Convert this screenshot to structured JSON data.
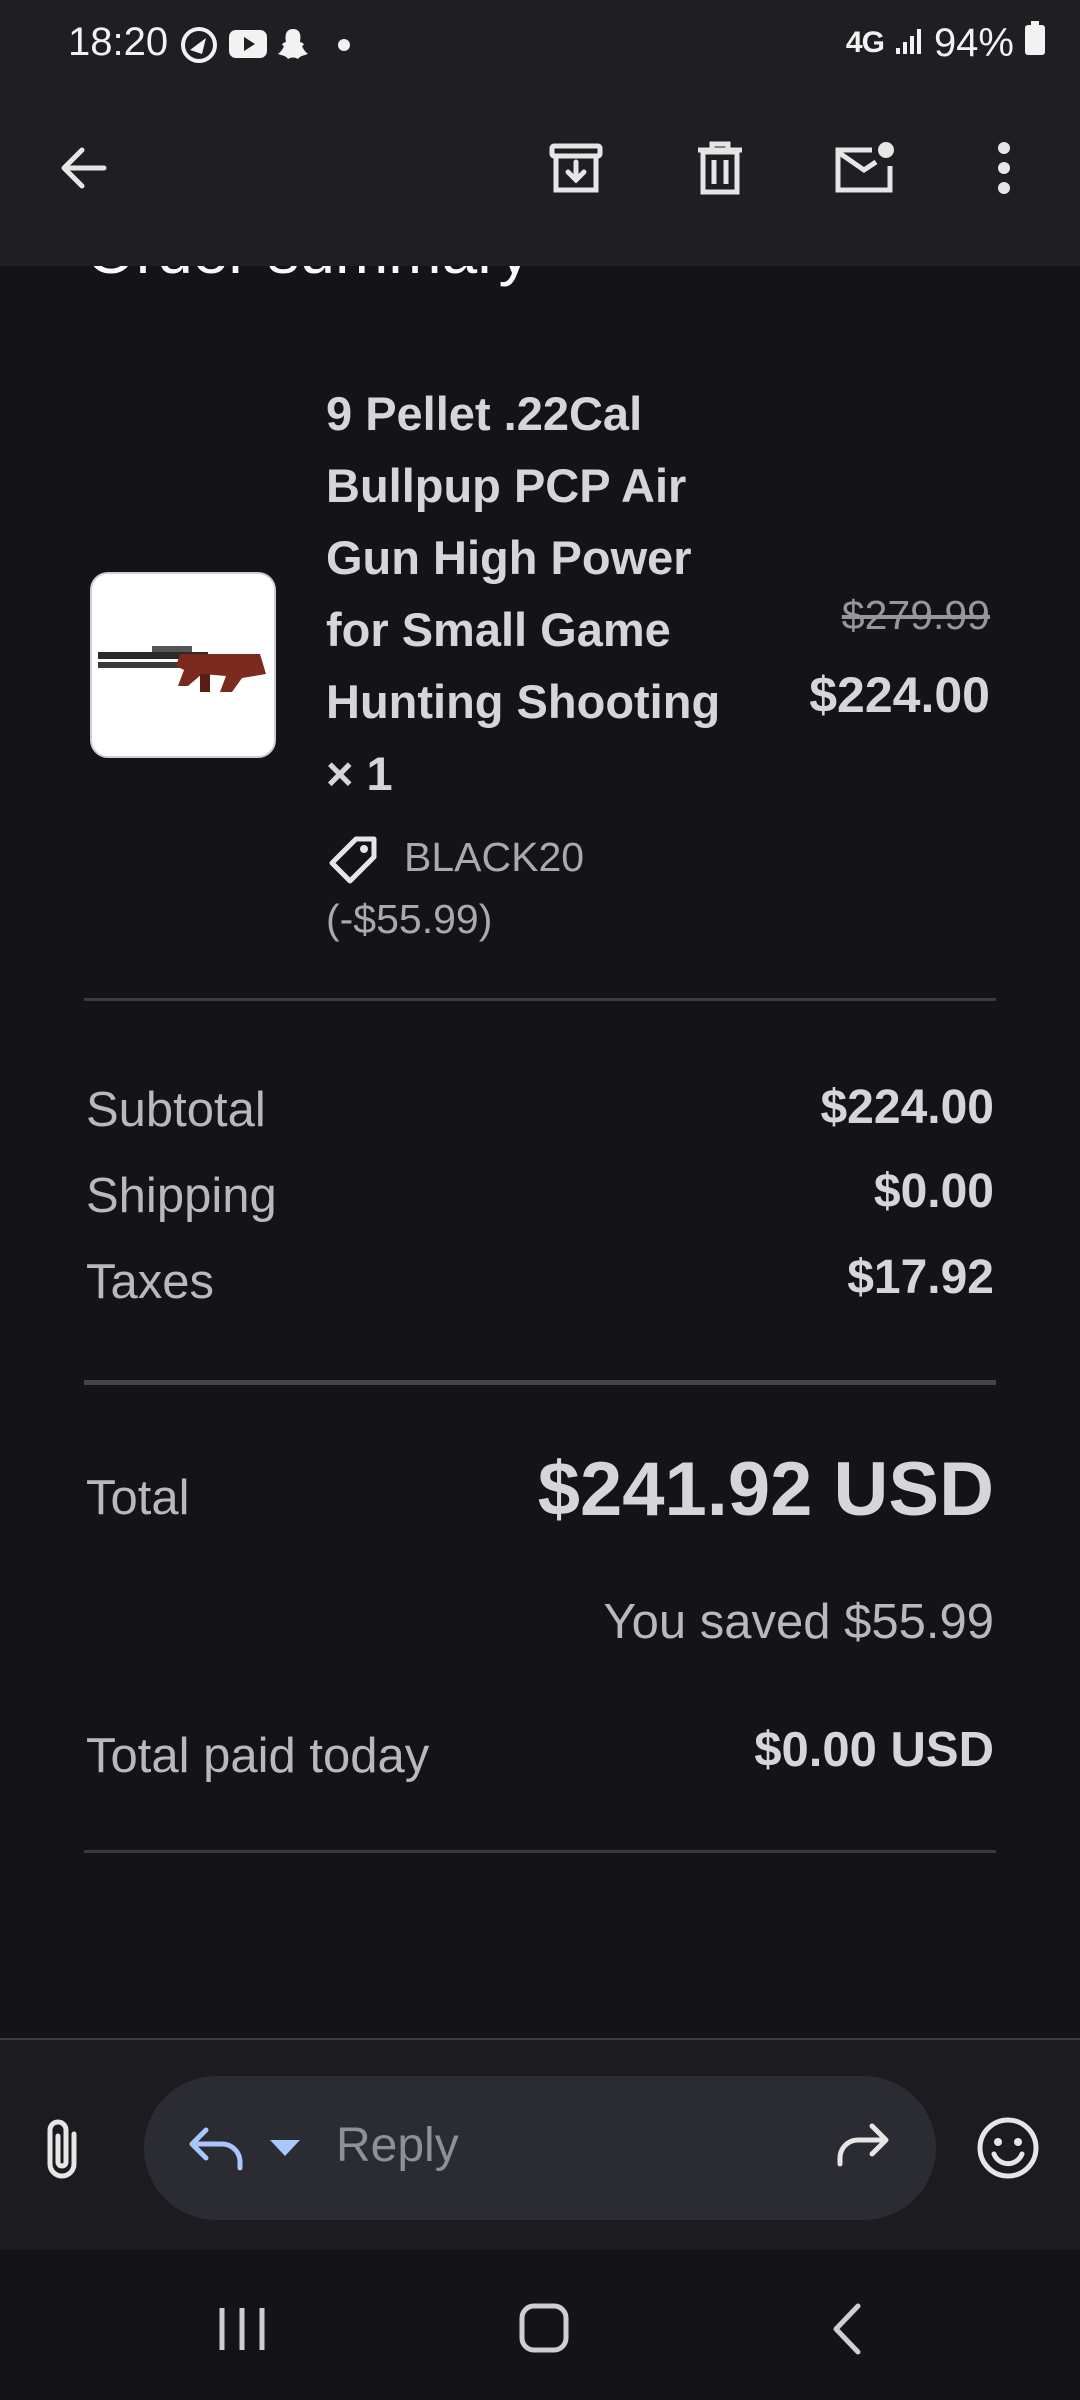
{
  "status_bar": {
    "time": "18:20",
    "network": "4G",
    "battery": "94%",
    "icons": [
      "camera-shutter-icon",
      "youtube-icon",
      "snapchat-like-icon",
      "dot-icon",
      "signal-icon",
      "battery-icon"
    ]
  },
  "toolbar": {
    "back": "arrow-back-icon",
    "archive": "archive-icon",
    "delete": "trash-icon",
    "mark_unread": "mail-unread-icon",
    "more": "more-vert-icon"
  },
  "email": {
    "section_title": "Order summary",
    "product": {
      "name": "9 Pellet .22Cal Bullpup PCP Air Gun High Power for Small Game Hunting Shooting × 1",
      "discount_code": "BLACK20",
      "discount_amount": "(-$55.99)",
      "original_price": "$279.99",
      "price": "$224.00"
    },
    "summary": {
      "subtotal_label": "Subtotal",
      "subtotal_value": "$224.00",
      "shipping_label": "Shipping",
      "shipping_value": "$0.00",
      "taxes_label": "Taxes",
      "taxes_value": "$17.92",
      "total_label": "Total",
      "total_value": "$241.92 USD",
      "saved_text": "You saved $55.99",
      "paid_label": "Total paid today",
      "paid_value": "$0.00 USD"
    }
  },
  "reply_bar": {
    "reply_placeholder": "Reply"
  },
  "colors": {
    "background": "#131318",
    "toolbar": "#1f1f23",
    "accent": "#a8c7fa"
  }
}
